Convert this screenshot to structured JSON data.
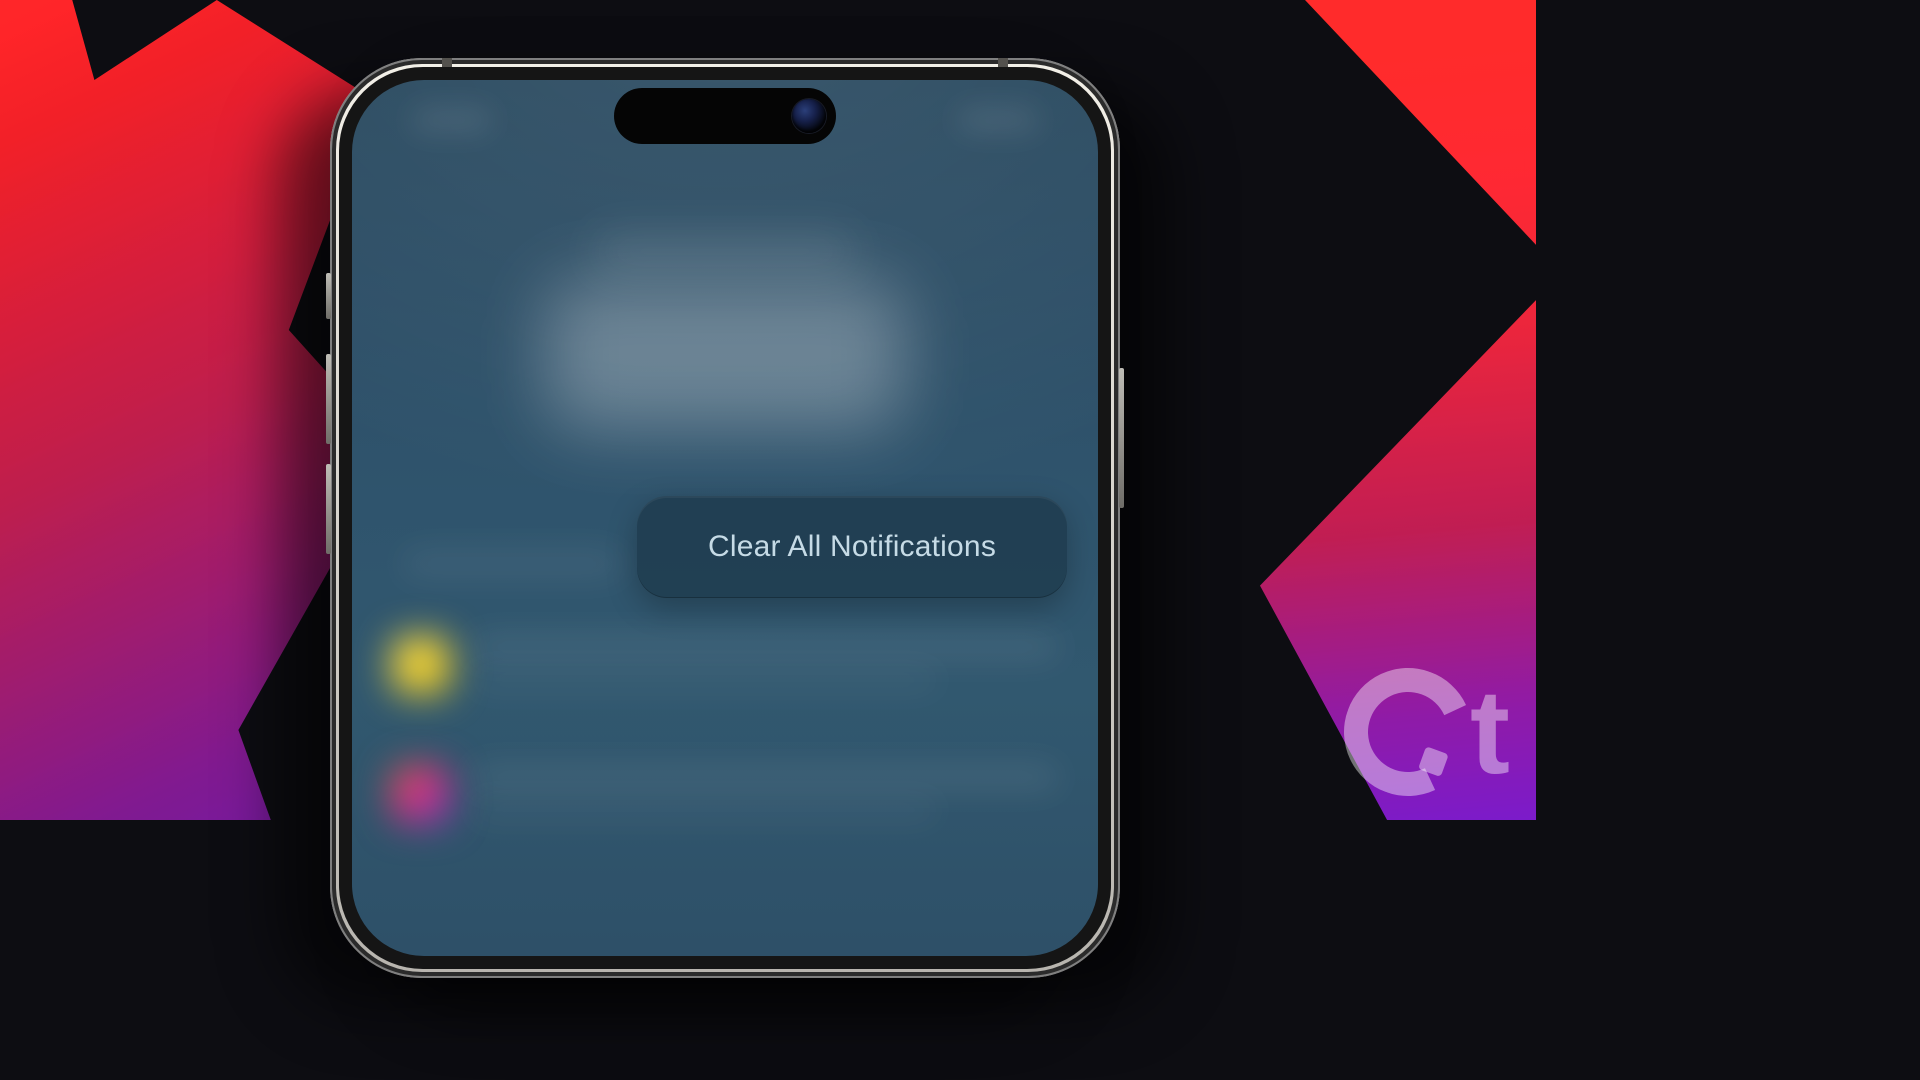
{
  "clear_button": {
    "label": "Clear All Notifications"
  },
  "watermark": {
    "text": "Gt"
  }
}
